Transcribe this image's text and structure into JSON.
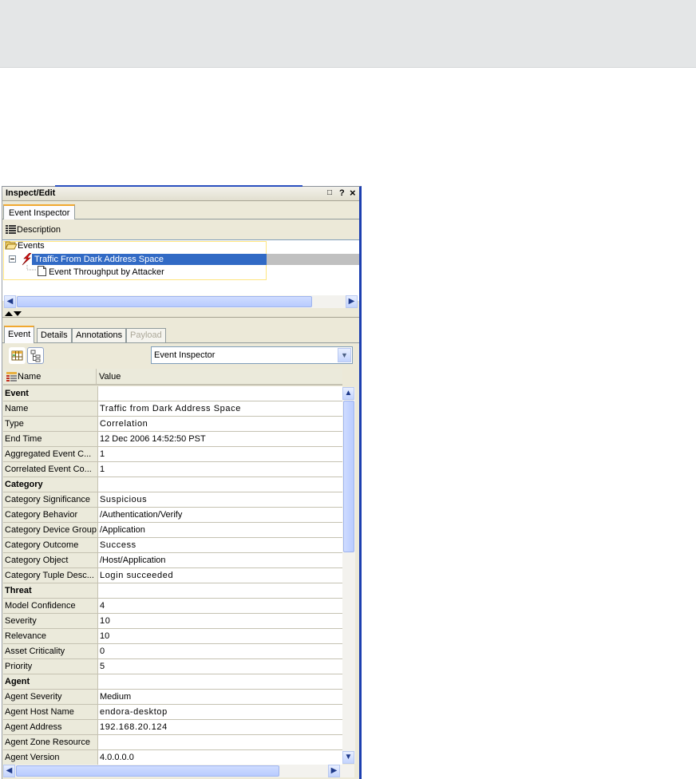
{
  "panel": {
    "title": "Inspect/Edit",
    "controls": {
      "restore": "□",
      "help": "?",
      "close": "×"
    }
  },
  "top_tab": "Event Inspector",
  "description_button": "Description",
  "tree": {
    "root": "Events",
    "selected": "Traffic From Dark Address Space",
    "child": "Event Throughput by Attacker"
  },
  "tabs": [
    {
      "label": "Event",
      "state": "active"
    },
    {
      "label": "Details",
      "state": "normal"
    },
    {
      "label": "Annotations",
      "state": "normal"
    },
    {
      "label": "Payload",
      "state": "disabled"
    }
  ],
  "view_select": {
    "value": "Event Inspector"
  },
  "grid": {
    "col_name": "Name",
    "col_value": "Value",
    "rows": [
      {
        "name": "Event",
        "value": "",
        "section": true
      },
      {
        "name": "Name",
        "value": "Traffic from Dark Address Space",
        "mono": true
      },
      {
        "name": "Type",
        "value": "Correlation",
        "mono": true
      },
      {
        "name": "End Time",
        "value": "12 Dec 2006 14:52:50 PST"
      },
      {
        "name": "Aggregated Event C...",
        "value": "1"
      },
      {
        "name": "Correlated Event Co...",
        "value": "1"
      },
      {
        "name": "Category",
        "value": "",
        "section": true
      },
      {
        "name": "Category Significance",
        "value": "Suspicious",
        "mono": true
      },
      {
        "name": "Category Behavior",
        "value": "/Authentication/Verify"
      },
      {
        "name": "Category Device Group",
        "value": "/Application"
      },
      {
        "name": "Category Outcome",
        "value": "Success",
        "mono": true
      },
      {
        "name": "Category Object",
        "value": "/Host/Application"
      },
      {
        "name": "Category Tuple Desc...",
        "value": "Login succeeded",
        "mono": true
      },
      {
        "name": "Threat",
        "value": "",
        "section": true
      },
      {
        "name": "Model Confidence",
        "value": "4"
      },
      {
        "name": "Severity",
        "value": "10",
        "mono": true
      },
      {
        "name": "Relevance",
        "value": "10"
      },
      {
        "name": "Asset Criticality",
        "value": "0"
      },
      {
        "name": "Priority",
        "value": "5"
      },
      {
        "name": "Agent",
        "value": "",
        "section": true
      },
      {
        "name": "Agent Severity",
        "value": "Medium"
      },
      {
        "name": "Agent Host Name",
        "value": "endora-desktop",
        "mono": true
      },
      {
        "name": "Agent Address",
        "value": "192.168.20.124",
        "mono": true
      },
      {
        "name": "Agent Zone Resource",
        "value": ""
      },
      {
        "name": "Agent Version",
        "value": "4.0.0.0.0"
      }
    ]
  },
  "colors": {
    "selection": "#316ac5",
    "tab_accent": "#f0a830",
    "window_border": "#1c3fb0"
  }
}
